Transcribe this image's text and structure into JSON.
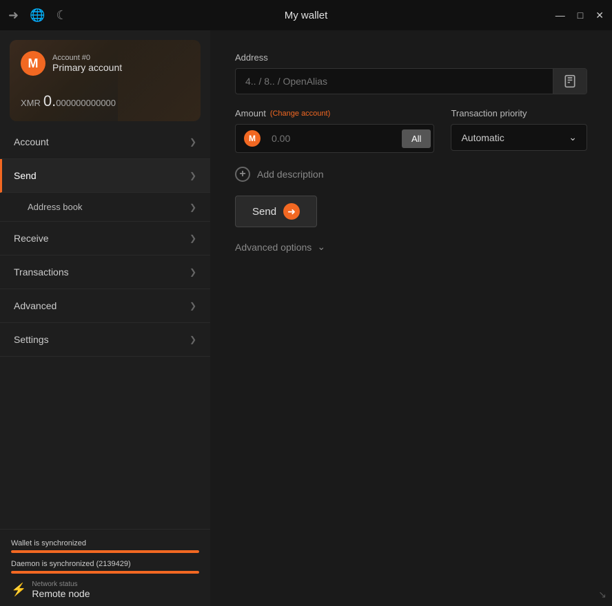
{
  "titlebar": {
    "title": "My wallet",
    "icons": {
      "arrow_icon": "→",
      "globe_icon": "🌐",
      "moon_icon": "🌙"
    },
    "controls": {
      "minimize": "—",
      "maximize": "□",
      "close": "✕"
    }
  },
  "wallet_card": {
    "account_number": "Account #0",
    "account_name": "Primary account",
    "currency": "XMR",
    "balance_whole": "0.",
    "balance_decimals": "000000000000",
    "monero_symbol": "M"
  },
  "sidebar": {
    "items": [
      {
        "id": "account",
        "label": "Account",
        "active": false,
        "has_sub": false
      },
      {
        "id": "send",
        "label": "Send",
        "active": true,
        "has_sub": true
      },
      {
        "id": "address-book",
        "label": "Address book",
        "active": false,
        "sub": true
      },
      {
        "id": "receive",
        "label": "Receive",
        "active": false,
        "has_sub": false
      },
      {
        "id": "transactions",
        "label": "Transactions",
        "active": false,
        "has_sub": false
      },
      {
        "id": "advanced",
        "label": "Advanced",
        "active": false,
        "has_sub": false
      },
      {
        "id": "settings",
        "label": "Settings",
        "active": false,
        "has_sub": false
      }
    ]
  },
  "main": {
    "address_label": "Address",
    "address_placeholder": "4.. / 8.. / OpenAlias",
    "amount_label": "Amount",
    "change_account_label": "(Change account)",
    "amount_placeholder": "0.00",
    "all_button": "All",
    "priority_label": "Transaction priority",
    "priority_value": "Automatic",
    "add_description_label": "Add description",
    "send_button": "Send",
    "advanced_options_label": "Advanced options"
  },
  "sync": {
    "wallet_sync_label": "Wallet is synchronized",
    "wallet_fill_pct": 100,
    "daemon_sync_label": "Daemon is synchronized (2139429)",
    "daemon_fill_pct": 100,
    "network_status_label": "Network status",
    "network_status_value": "Remote node"
  }
}
